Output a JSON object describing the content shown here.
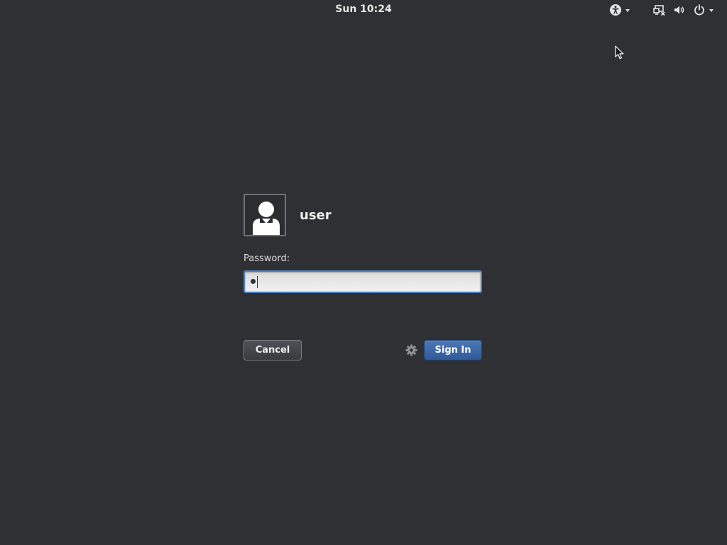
{
  "topbar": {
    "clock": "Sun 10:24",
    "icons": [
      "accessibility-icon",
      "network-wired-disconnected-icon",
      "volume-icon",
      "power-icon"
    ]
  },
  "login": {
    "username": "user",
    "password_label": "Password:",
    "password_masked": "•",
    "cancel_label": "Cancel",
    "signin_label": "Sign In",
    "session_icon": "gear-icon"
  },
  "colors": {
    "background": "#2e3034",
    "accent": "#4a7ab8",
    "text": "#eeeeec"
  }
}
